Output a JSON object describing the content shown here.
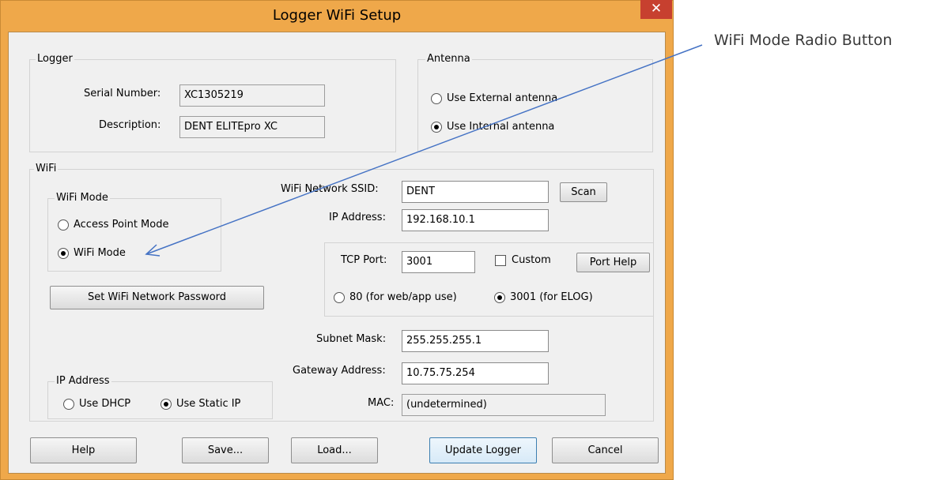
{
  "window": {
    "title": "Logger WiFi Setup",
    "close_glyph": "✕"
  },
  "logger": {
    "group_label": "Logger",
    "serial_label": "Serial Number:",
    "serial_value": "XC1305219",
    "description_label": "Description:",
    "description_value": "DENT ELITEpro XC"
  },
  "antenna": {
    "group_label": "Antenna",
    "external_label": "Use External antenna",
    "internal_label": "Use Internal antenna",
    "selected": "internal"
  },
  "wifi": {
    "group_label": "WiFi",
    "mode": {
      "group_label": "WiFi Mode",
      "access_point_label": "Access Point Mode",
      "wifi_mode_label": "WiFi Mode",
      "selected": "wifi"
    },
    "set_password_label": "Set WiFi Network Password",
    "ssid_label": "WiFi Network SSID:",
    "ssid_value": "DENT",
    "scan_label": "Scan",
    "ip_address_label": "IP Address:",
    "ip_address_value": "192.168.10.1",
    "tcp_port_label": "TCP Port:",
    "tcp_port_value": "3001",
    "custom_label": "Custom",
    "custom_checked": false,
    "port_help_label": "Port Help",
    "port80_label": "80 (for web/app use)",
    "port3001_label": "3001 (for ELOG)",
    "port_selected": "3001",
    "subnet_label": "Subnet Mask:",
    "subnet_value": "255.255.255.1",
    "gateway_label": "Gateway Address:",
    "gateway_value": "10.75.75.254",
    "mac_label": "MAC:",
    "mac_value": "(undetermined)",
    "ip_mode": {
      "group_label": "IP Address",
      "dhcp_label": "Use DHCP",
      "static_label": "Use Static IP",
      "selected": "static"
    }
  },
  "buttons": {
    "help": "Help",
    "save": "Save...",
    "load": "Load...",
    "update": "Update Logger",
    "cancel": "Cancel"
  },
  "annotation": {
    "text": "WiFi Mode Radio Button",
    "arrow_color": "#4472c4"
  },
  "colors": {
    "frame": "#efa84a",
    "close": "#c7402f",
    "dialog_bg": "#f0f0f0"
  }
}
